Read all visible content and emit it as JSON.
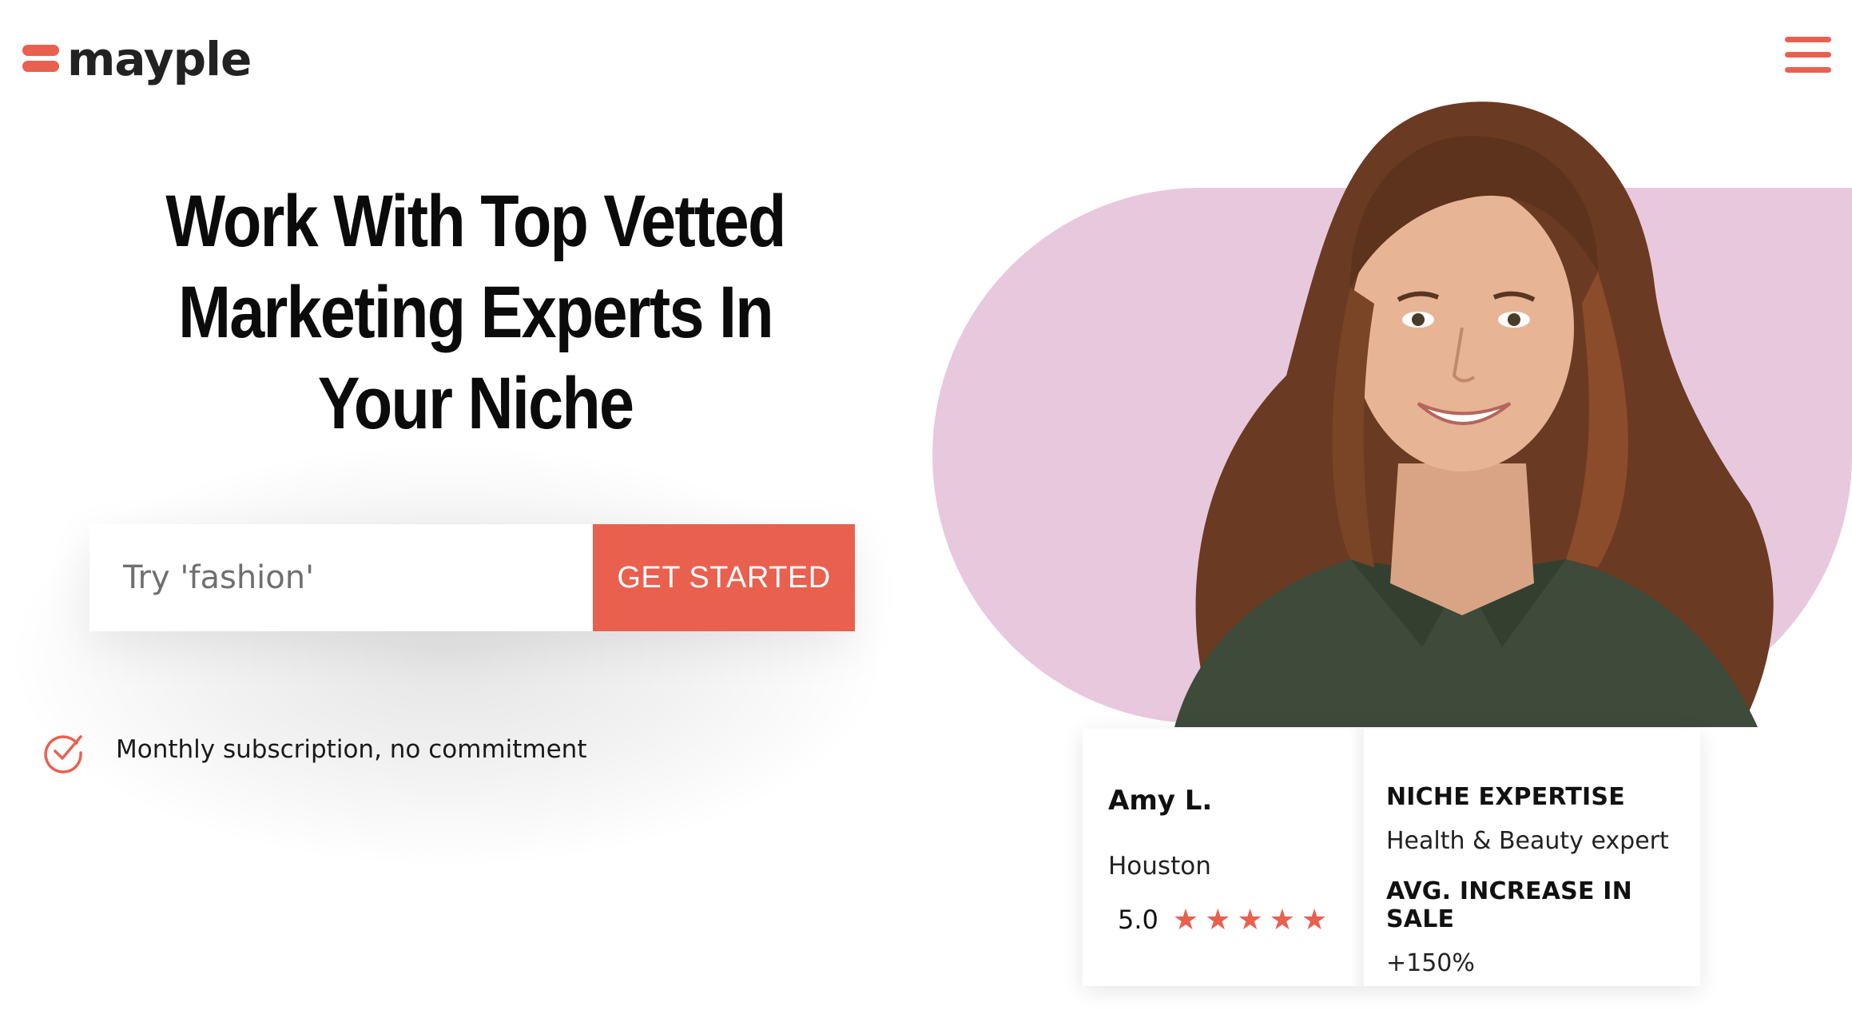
{
  "brand": {
    "name": "mayple",
    "accent": "#e9604f",
    "blob_color": "#e8c8dd"
  },
  "nav": {
    "menu_icon": "hamburger-icon"
  },
  "hero": {
    "headline_line1": "Work With Top Vetted",
    "headline_line2": "Marketing Experts In",
    "headline_line3": "Your Niche",
    "search_placeholder": "Try 'fashion'",
    "cta_label": "GET STARTED",
    "benefit_text": "Monthly subscription, no commitment",
    "benefit_icon": "check-circle-icon"
  },
  "expert": {
    "name": "Amy L.",
    "city": "Houston",
    "rating": "5.0",
    "stars": 5,
    "niche_label": "NICHE EXPERTISE",
    "niche_value": "Health & Beauty expert",
    "sale_label": "AVG. INCREASE IN SALE",
    "sale_value": "+150%"
  }
}
